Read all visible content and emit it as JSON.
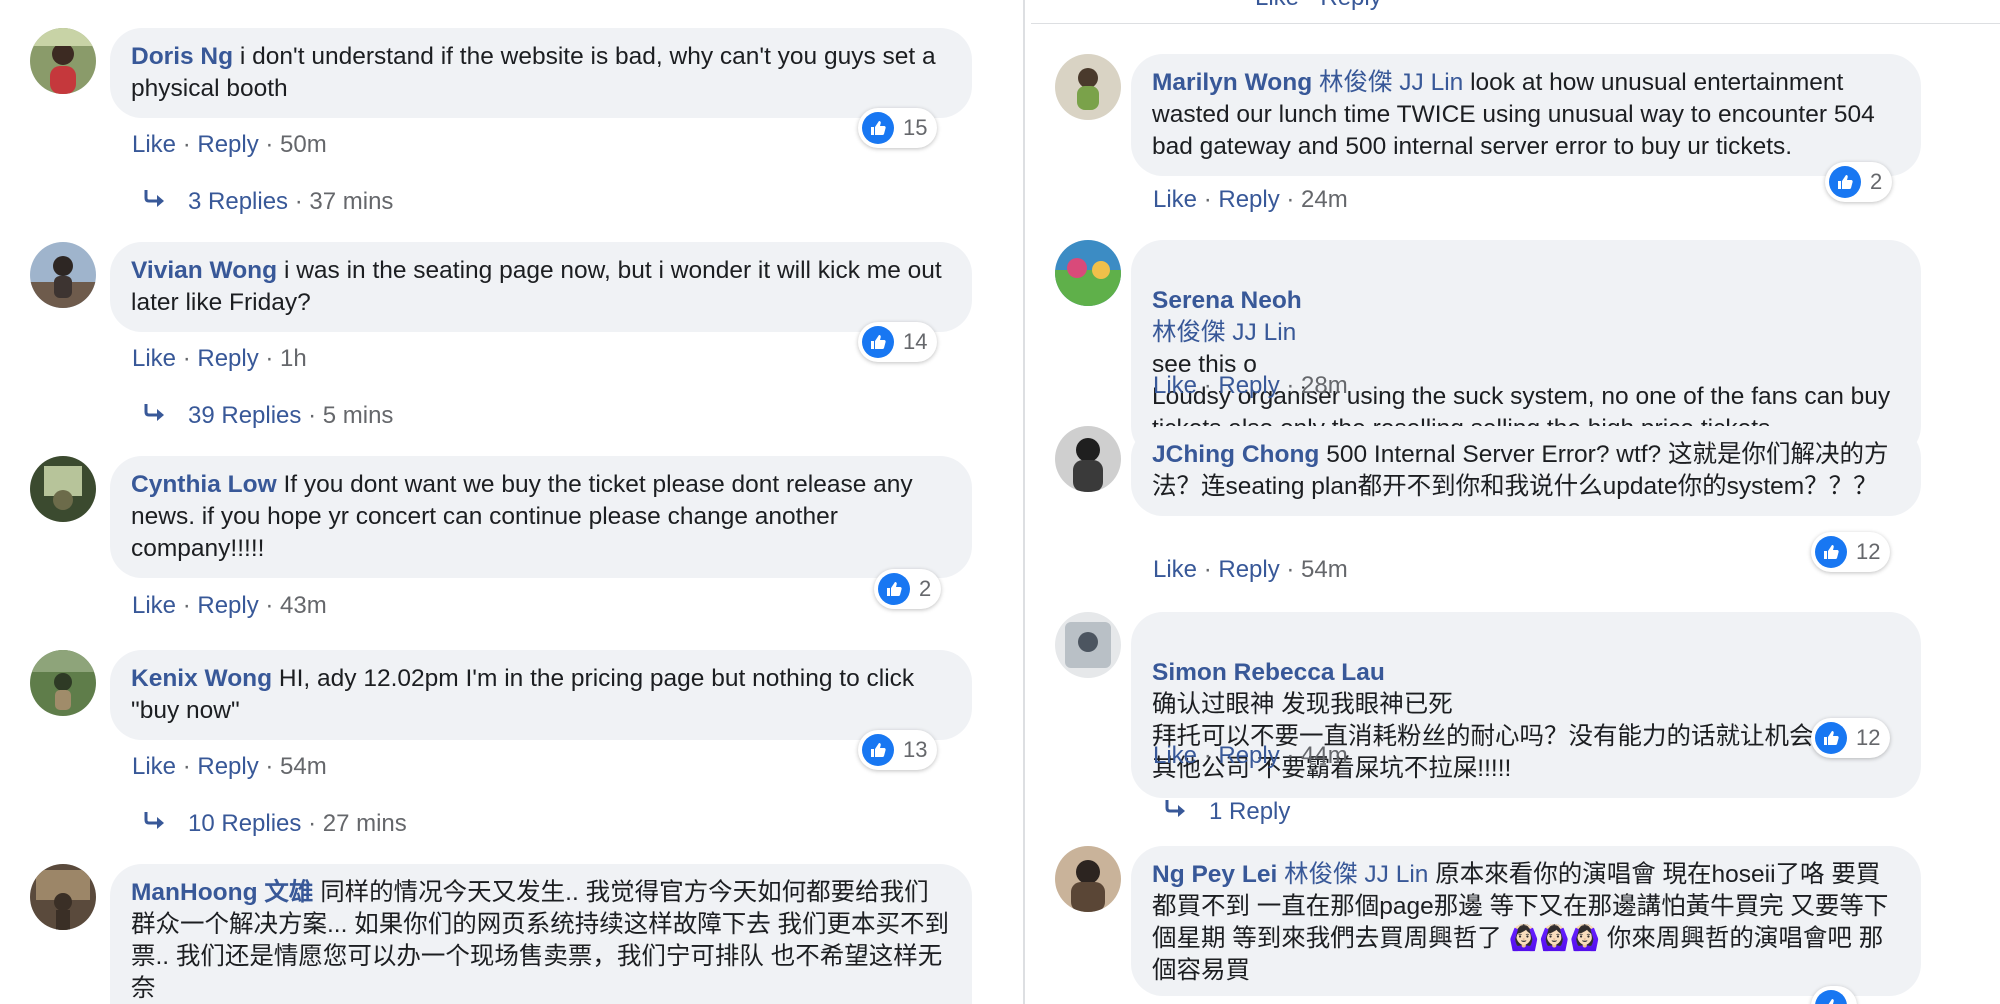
{
  "left": {
    "comments": [
      {
        "author": "Doris Ng",
        "text": "i don't understand if the website is bad, why can't you guys set a physical booth",
        "likes": "15",
        "like_label": "Like",
        "reply_label": "Reply",
        "time": "50m",
        "replies_label": "3 Replies",
        "replies_time": "37 mins",
        "avatar_colors": [
          "#8a9b6a",
          "#c5383c",
          "#3c2a22"
        ]
      },
      {
        "author": "Vivian Wong",
        "text": "i was in the seating page now, but i wonder it will kick me out later like Friday?",
        "likes": "14",
        "like_label": "Like",
        "reply_label": "Reply",
        "time": "1h",
        "replies_label": "39 Replies",
        "replies_time": "5 mins",
        "avatar_colors": [
          "#9fb4cc",
          "#6e5b4c",
          "#2d2623"
        ]
      },
      {
        "author": "Cynthia Low",
        "text": "If you dont want we buy the ticket please dont release any news. if you hope yr concert can continue please change another company!!!!!",
        "likes": "2",
        "like_label": "Like",
        "reply_label": "Reply",
        "time": "43m",
        "avatar_colors": [
          "#3b4a2f",
          "#b7c49a",
          "#6c6b4a"
        ]
      },
      {
        "author": "Kenix Wong",
        "text": "HI, ady 12.02pm I'm in the pricing page but nothing to click \"buy now\"",
        "likes": "13",
        "like_label": "Like",
        "reply_label": "Reply",
        "time": "54m",
        "replies_label": "10 Replies",
        "replies_time": "27 mins",
        "avatar_colors": [
          "#5f7d4a",
          "#a08c6a",
          "#2e3a25"
        ]
      },
      {
        "author": "ManHoong 文雄",
        "text": "同样的情况今天又发生.. 我觉得官方今天如何都要给我们群众一个解决方案... 如果你们的网页系统持续这样故障下去 我们更本买不到票.. 我们还是情愿您可以办一个现场售卖票，我们宁可排队 也不希望这样无奈",
        "avatar_colors": [
          "#5a4a3c",
          "#9c8668",
          "#3a2f26"
        ]
      }
    ]
  },
  "right": {
    "top_cut_text": "Like · Reply",
    "comments": [
      {
        "author": "Marilyn Wong",
        "tag": "林俊傑 JJ Lin",
        "text": "look at how unusual entertainment wasted our lunch time TWICE using unusual way to encounter 504 bad gateway and 500 internal server error to buy ur tickets.",
        "likes": "2",
        "like_label": "Like",
        "reply_label": "Reply",
        "time": "24m",
        "avatar_colors": [
          "#d9d3c4",
          "#7aa24a",
          "#4a3a2c"
        ]
      },
      {
        "author": "Serena Neoh",
        "tag": "林俊傑 JJ Lin",
        "text": "see this o\nLoudsy organiser using the suck system, no one of the fans can buy tickets also only the reselling selling the high price tickets",
        "like_label": "Like",
        "reply_label": "Reply",
        "time": "28m",
        "avatar_colors": [
          "#d94a7a",
          "#3c8cc4",
          "#5fb04a"
        ]
      },
      {
        "author": "JChing Chong",
        "text": "500 Internal Server Error? wtf? 这就是你们解决的方法？连seating plan都开不到你和我说什么update你的system？？？",
        "likes": "12",
        "like_label": "Like",
        "reply_label": "Reply",
        "time": "54m",
        "avatar_colors": [
          "#1f1f1f",
          "#cfcfcf",
          "#3a3a3a"
        ]
      },
      {
        "author": "Simon Rebecca Lau",
        "text": "确认过眼神 发现我眼神已死\n拜托可以不要一直消耗粉丝的耐心吗？没有能力的话就让机会出来给其他公司 不要霸着屎坑不拉屎!!!!!",
        "likes": "12",
        "like_label": "Like",
        "reply_label": "Reply",
        "time": "44m",
        "replies_label": "1 Reply",
        "avatar_colors": [
          "#b9c0c6",
          "#4c5560",
          "#e6e8ea"
        ]
      },
      {
        "author": "Ng Pey Lei",
        "tag": "林俊傑 JJ Lin",
        "text": "原本來看你的演唱會 現在hoseii了咯 要買都買不到 一直在那個page那邊 等下又在那邊講怕黃牛買完 又要等下個星期 等到來我們去買周興哲了 🙆🏻‍♀️🙆🏻‍♀️🙆🏻‍♀️ 你來周興哲的演唱會吧 那個容易買",
        "avatar_colors": [
          "#2c2420",
          "#c9b39a",
          "#5a4636"
        ]
      }
    ]
  }
}
